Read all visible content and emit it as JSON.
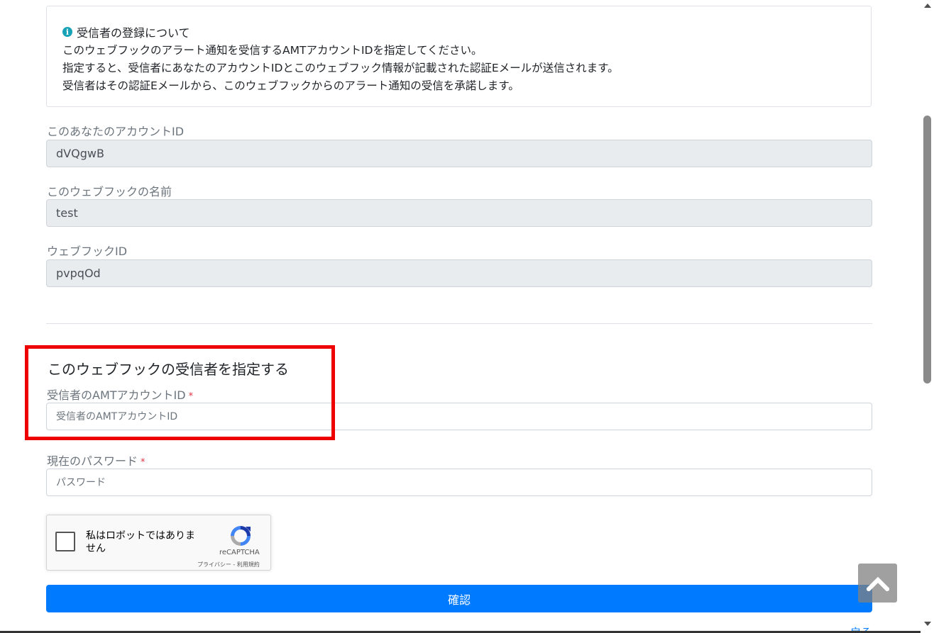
{
  "info": {
    "title": "受信者の登録について",
    "lines": [
      "このウェブフックのアラート通知を受信するAMTアカウントIDを指定してください。",
      "指定すると、受信者にあなたのアカウントIDとこのウェブフック情報が記載された認証Eメールが送信されます。",
      "受信者はその認証Eメールから、このウェブフックからのアラート通知の受信を承諾します。"
    ],
    "icon": "info-circle-icon"
  },
  "account_id": {
    "label": "このあなたのアカウントID",
    "value": "dVQgwB"
  },
  "webhook_name": {
    "label": "このウェブフックの名前",
    "value": "test"
  },
  "webhook_id": {
    "label": "ウェブフックID",
    "value": "pvpqOd"
  },
  "recipient_section": {
    "heading": "このウェブフックの受信者を指定する",
    "amt_label": "受信者のAMTアカウントID",
    "amt_placeholder": "受信者のAMTアカウントID",
    "password_label": "現在のパスワード",
    "password_placeholder": "パスワード",
    "required_mark": "*"
  },
  "recaptcha": {
    "label": "私はロボットではありません",
    "brand": "reCAPTCHA",
    "links": "プライバシー - 利用規約"
  },
  "submit": {
    "label": "確認"
  },
  "bottom_link": {
    "label": "戻る"
  },
  "colors": {
    "primary": "#007bff",
    "highlight": "#ee0000",
    "info": "#17a2b8",
    "required": "#dc3545"
  }
}
